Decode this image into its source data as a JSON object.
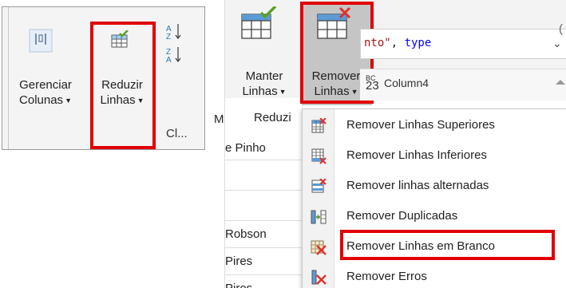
{
  "left_ribbon": {
    "gerenciar": {
      "line1": "Gerenciar",
      "line2": "Colunas"
    },
    "reduzir": {
      "line1": "Reduzir",
      "line2": "Linhas"
    },
    "sort_az": "A↓",
    "group_label": "Cl..."
  },
  "right_ribbon": {
    "manter": {
      "line1": "Manter",
      "line2": "Linhas"
    },
    "remover": {
      "line1": "Remover",
      "line2": "Linhas"
    },
    "group_label": "Reduzi",
    "formula": {
      "part1": "nto\"",
      "part2": ", ",
      "part3": "type"
    },
    "column_header": {
      "type_badge_top": "BC",
      "type_badge_bottom": "23",
      "name": "Column4"
    },
    "left_letter": "M"
  },
  "grid_cells": [
    "e Pinho",
    "Robson",
    "Pires",
    "Pires"
  ],
  "menu": {
    "items": [
      {
        "label": "Remover Linhas Superiores",
        "icon": "remove-top-rows-icon"
      },
      {
        "label": "Remover Linhas Inferiores",
        "icon": "remove-bottom-rows-icon"
      },
      {
        "label": "Remover linhas alternadas",
        "icon": "remove-alternate-rows-icon"
      },
      {
        "label": "Remover Duplicadas",
        "icon": "remove-duplicates-icon"
      },
      {
        "label": "Remover Linhas em Branco",
        "icon": "remove-blank-rows-icon"
      },
      {
        "label": "Remover Erros",
        "icon": "remove-errors-icon"
      }
    ]
  },
  "colors": {
    "highlight": "#e00000",
    "accent": "#2e75b6",
    "red_x": "#e0312b",
    "green": "#5aa02c"
  }
}
